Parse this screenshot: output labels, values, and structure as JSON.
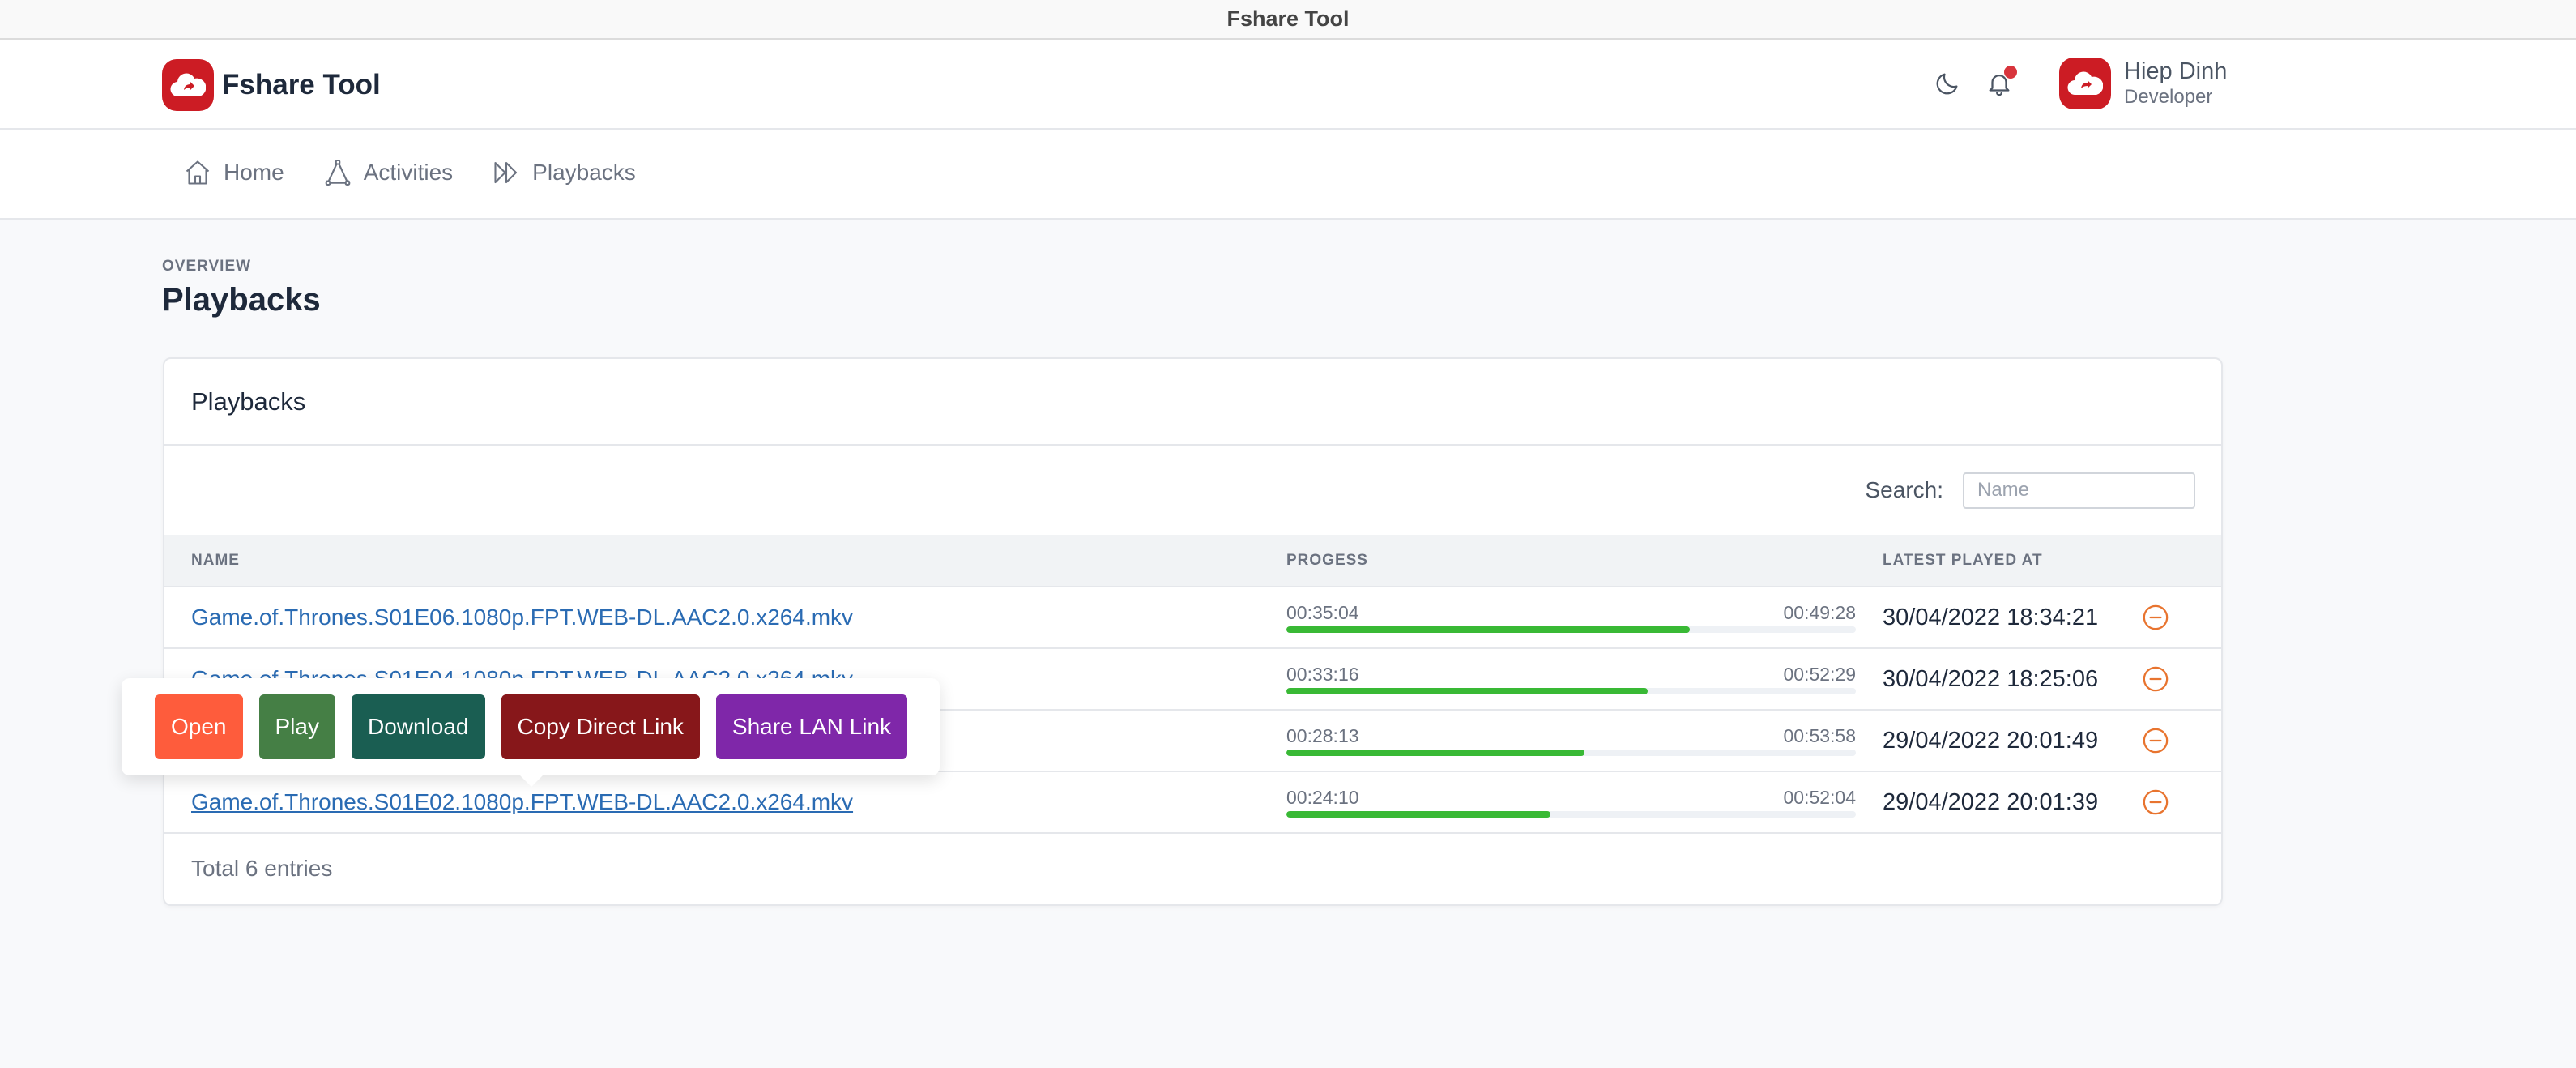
{
  "window": {
    "title": "Fshare Tool"
  },
  "header": {
    "brand_name": "Fshare Tool",
    "logo_icon": "cloud-share-icon",
    "theme_icon": "moon-icon",
    "notification_icon": "bell-icon",
    "has_notification": true,
    "user": {
      "name": "Hiep Dinh",
      "role": "Developer"
    }
  },
  "nav": {
    "items": [
      {
        "label": "Home",
        "icon": "home-icon"
      },
      {
        "label": "Activities",
        "icon": "activities-icon"
      },
      {
        "label": "Playbacks",
        "icon": "playbacks-icon"
      }
    ]
  },
  "page": {
    "overline": "OVERVIEW",
    "title": "Playbacks"
  },
  "card": {
    "title": "Playbacks",
    "search": {
      "label": "Search:",
      "placeholder": "Name",
      "value": ""
    },
    "columns": {
      "name": "NAME",
      "progress": "PROGESS",
      "latest": "LATEST PLAYED AT"
    },
    "rows": [
      {
        "name": "Game.of.Thrones.S01E06.1080p.FPT.WEB-DL.AAC2.0.x264.mkv",
        "current": "00:35:04",
        "duration": "00:49:28",
        "progress_pct": 70.9,
        "latest": "30/04/2022 18:34:21"
      },
      {
        "name": "Game.of.Thrones.S01E04.1080p.FPT.WEB-DL.AAC2.0.x264.mkv",
        "current": "00:33:16",
        "duration": "00:52:29",
        "progress_pct": 63.4,
        "latest": "30/04/2022 18:25:06"
      },
      {
        "name": "",
        "current": "00:28:13",
        "duration": "00:53:58",
        "progress_pct": 52.3,
        "latest": "29/04/2022 20:01:49"
      },
      {
        "name": "Game.of.Thrones.S01E02.1080p.FPT.WEB-DL.AAC2.0.x264.mkv",
        "current": "00:24:10",
        "duration": "00:52:04",
        "progress_pct": 46.4,
        "latest": "29/04/2022 20:01:39"
      }
    ],
    "footer": "Total 6 entries"
  },
  "popover": {
    "buttons": [
      {
        "label": "Open",
        "color": "#fe5c3c"
      },
      {
        "label": "Play",
        "color": "#457f45"
      },
      {
        "label": "Download",
        "color": "#1a5e52"
      },
      {
        "label": "Copy Direct Link",
        "color": "#87171a"
      },
      {
        "label": "Share LAN Link",
        "color": "#7f27a9"
      }
    ]
  },
  "colors": {
    "brand": "#cc1c24",
    "link": "#2a6bb3",
    "progress": "#39b935",
    "remove": "#e8742f"
  }
}
